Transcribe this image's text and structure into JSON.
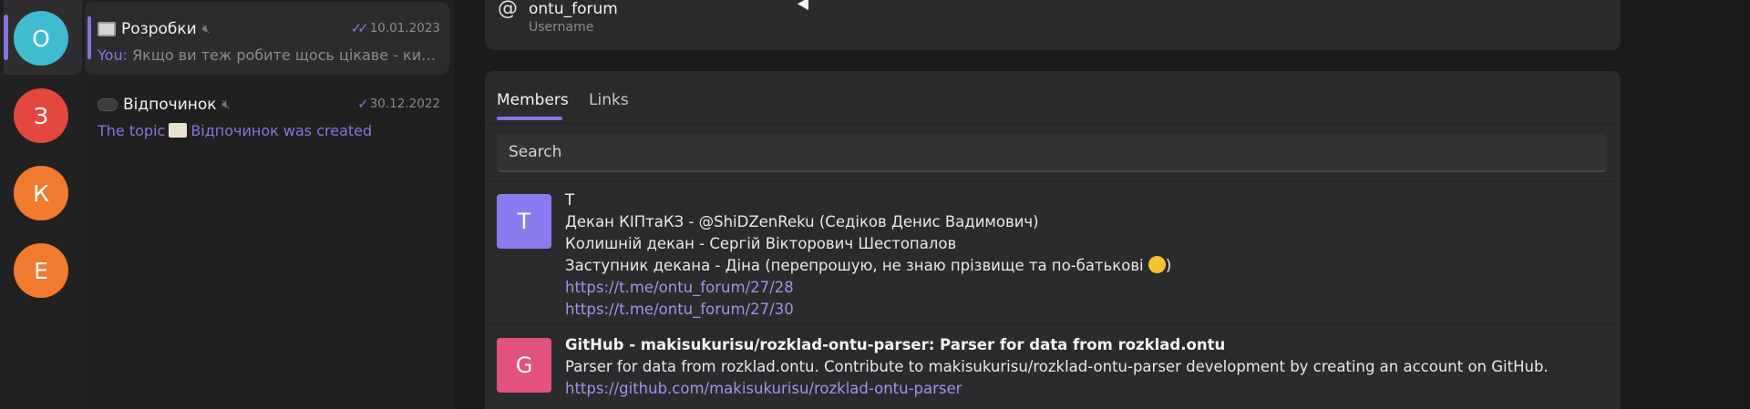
{
  "rail": {
    "items": [
      {
        "letter": "О",
        "color": "#3fbcd0",
        "active": true
      },
      {
        "letter": "З",
        "color": "#e5473f"
      },
      {
        "letter": "К",
        "color": "#f07b2f"
      },
      {
        "letter": "Е",
        "color": "#f07b2f"
      }
    ]
  },
  "chats": [
    {
      "title": "Розробки",
      "date": "10.01.2023",
      "sender": "You:",
      "preview": "Якщо ви теж робите щось цікаве - кидайте сюди",
      "selected": true
    },
    {
      "title": "Відпочинок",
      "date": "30.12.2022",
      "preview_prefix": "The topic",
      "preview_suffix": "Відпочинок was created"
    }
  ],
  "info": {
    "username": "ontu_forum",
    "username_label": "Username"
  },
  "tabs": [
    {
      "label": "Members",
      "active": true
    },
    {
      "label": "Links"
    }
  ],
  "search": {
    "placeholder": "Search"
  },
  "links": [
    {
      "avatar_letter": "T",
      "avatar_color": "#8a7cf0",
      "title": "T",
      "lines": [
        "Декан КІПтаКЗ - @ShiDZenReku (Седіков Денис Вадимович)",
        "Колишній декан - Сергій Вікторович Шестопалов",
        "Заступник декана - Діна (перепрошую, не знаю прізвище та по-батькові"
      ],
      "line_suffix": ")",
      "urls": [
        "https://t.me/ontu_forum/27/28",
        "https://t.me/ontu_forum/27/30"
      ]
    },
    {
      "avatar_letter": "G",
      "avatar_color": "#e3527f",
      "title": "GitHub - makisukurisu/rozklad-ontu-parser: Parser for data from rozklad.ontu",
      "lines": [
        "Parser for data from rozklad.ontu. Contribute to makisukurisu/rozklad-ontu-parser development by creating an account on GitHub."
      ],
      "urls": [
        "https://github.com/makisukurisu/rozklad-ontu-parser"
      ]
    }
  ]
}
